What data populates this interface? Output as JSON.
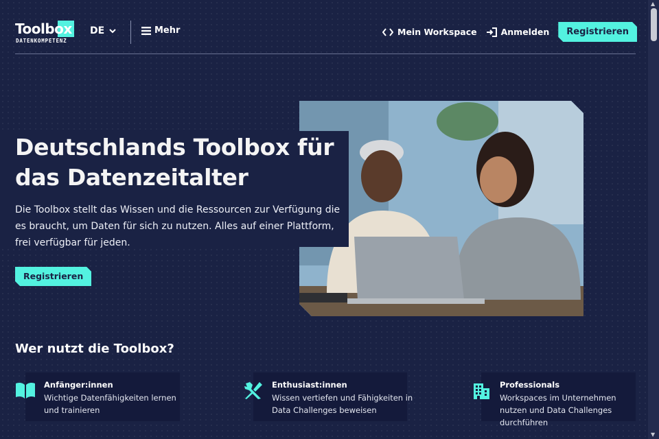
{
  "header": {
    "logo_text": "Toolbox",
    "logo_subtext": "DATENKOMPETENZ",
    "language": "DE",
    "more_label": "Mehr",
    "workspace_label": "Mein Workspace",
    "login_label": "Anmelden",
    "register_label": "Registrieren"
  },
  "hero": {
    "title": "Deutschlands Toolbox für das Datenzeitalter",
    "description": "Die Toolbox stellt das Wissen und die Ressourcen zur Verfügung die es braucht, um Daten für sich zu nutzen. Alles auf einer Plattform, frei verfügbar für jeden.",
    "cta_label": "Registrieren"
  },
  "audience": {
    "title": "Wer nutzt die Toolbox?",
    "cards": [
      {
        "icon": "book-icon",
        "title": "Anfänger:innen",
        "text": "Wichtige Datenfähigkeiten lernen und trainieren"
      },
      {
        "icon": "tools-icon",
        "title": "Enthusiast:innen",
        "text": "Wissen vertiefen und Fähigkeiten in Data Challenges beweisen"
      },
      {
        "icon": "building-icon",
        "title": "Professionals",
        "text": "Workspaces im Unternehmen nutzen und Data Challenges durchführen"
      }
    ]
  },
  "colors": {
    "background": "#1a2244",
    "accent": "#53f2e0",
    "card_background": "#141a3b"
  }
}
